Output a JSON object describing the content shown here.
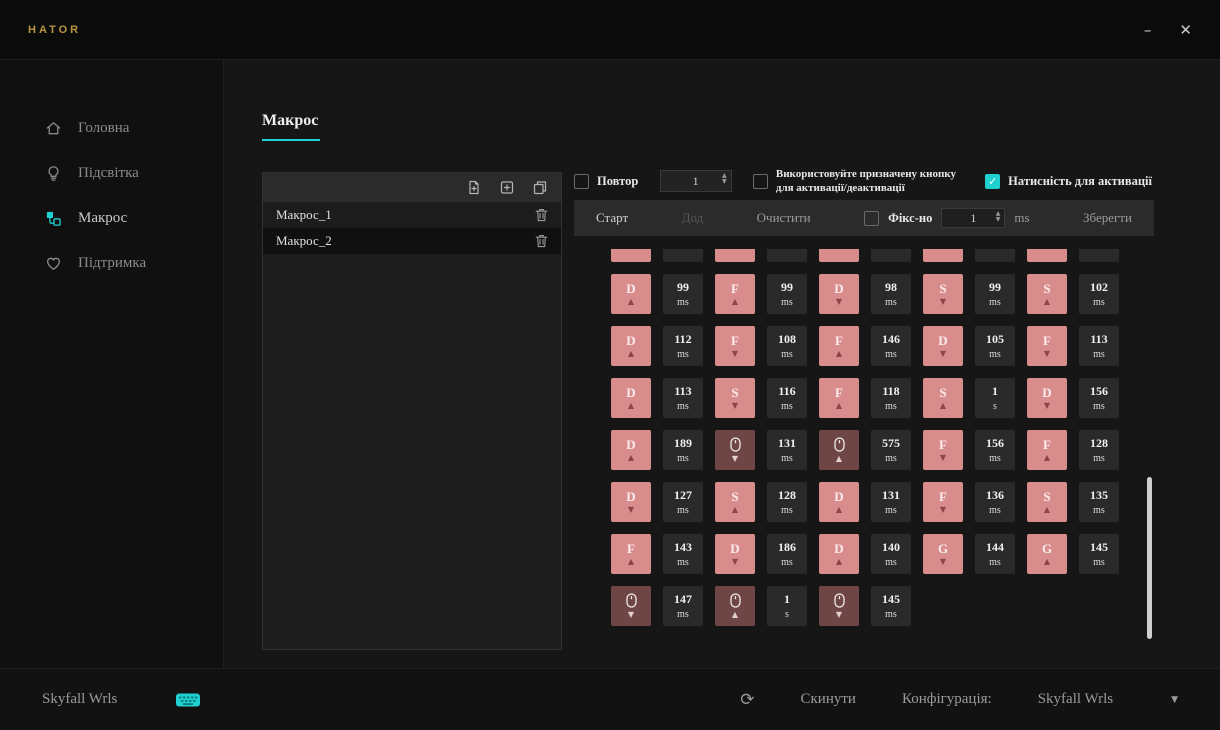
{
  "topbar": {
    "brand": "HATOR",
    "minimize": "–",
    "close": "✕"
  },
  "sidebar": {
    "items": [
      {
        "label": "Головна",
        "icon": "home-icon",
        "active": false
      },
      {
        "label": "Підсвітка",
        "icon": "bulb-icon",
        "active": false
      },
      {
        "label": "Макрос",
        "icon": "macro-icon",
        "active": true
      },
      {
        "label": "Підтримка",
        "icon": "heart-icon",
        "active": false
      }
    ]
  },
  "page": {
    "title": "Макрос"
  },
  "macro_list": {
    "toolbar_icons": [
      "new-file-icon",
      "add-file-icon",
      "copy-icon"
    ],
    "items": [
      {
        "name": "Макрос_1",
        "selected": false
      },
      {
        "name": "Макрос_2",
        "selected": true
      }
    ]
  },
  "controls": {
    "repeat": {
      "label": "Повтор",
      "checked": false,
      "value": "1"
    },
    "assigned_button": {
      "label": "Використовуйте призначену кнопку для активації/деактивації",
      "checked": false
    },
    "press_to_activate": {
      "label": "Натисність для активації",
      "checked": true
    }
  },
  "action_bar": {
    "start": "Старт",
    "add": "Дод",
    "clear": "Очистити",
    "fixed": {
      "label": "Фікс-но",
      "checked": false,
      "value": "1",
      "unit": "ms"
    },
    "save": "Зберегти"
  },
  "events": {
    "partial_top_row_pairs": 5,
    "rows": [
      [
        {
          "key": "D",
          "dir": "up",
          "time": "99",
          "unit": "ms"
        },
        {
          "key": "F",
          "dir": "up",
          "time": "99",
          "unit": "ms"
        },
        {
          "key": "D",
          "dir": "down",
          "time": "98",
          "unit": "ms"
        },
        {
          "key": "S",
          "dir": "down",
          "time": "99",
          "unit": "ms"
        },
        {
          "key": "S",
          "dir": "up",
          "time": "102",
          "unit": "ms"
        }
      ],
      [
        {
          "key": "D",
          "dir": "up",
          "time": "112",
          "unit": "ms"
        },
        {
          "key": "F",
          "dir": "down",
          "time": "108",
          "unit": "ms"
        },
        {
          "key": "F",
          "dir": "up",
          "time": "146",
          "unit": "ms"
        },
        {
          "key": "D",
          "dir": "down",
          "time": "105",
          "unit": "ms"
        },
        {
          "key": "F",
          "dir": "down",
          "time": "113",
          "unit": "ms"
        }
      ],
      [
        {
          "key": "D",
          "dir": "up",
          "time": "113",
          "unit": "ms"
        },
        {
          "key": "S",
          "dir": "down",
          "time": "116",
          "unit": "ms"
        },
        {
          "key": "F",
          "dir": "up",
          "time": "118",
          "unit": "ms"
        },
        {
          "key": "S",
          "dir": "up",
          "time": "1",
          "unit": "s"
        },
        {
          "key": "D",
          "dir": "down",
          "time": "156",
          "unit": "ms"
        }
      ],
      [
        {
          "key": "D",
          "dir": "up",
          "time": "189",
          "unit": "ms"
        },
        {
          "key": "mouse",
          "dir": "down",
          "time": "131",
          "unit": "ms"
        },
        {
          "key": "mouse",
          "dir": "up",
          "time": "575",
          "unit": "ms"
        },
        {
          "key": "F",
          "dir": "down",
          "time": "156",
          "unit": "ms"
        },
        {
          "key": "F",
          "dir": "up",
          "time": "128",
          "unit": "ms"
        }
      ],
      [
        {
          "key": "D",
          "dir": "down",
          "time": "127",
          "unit": "ms"
        },
        {
          "key": "S",
          "dir": "up",
          "time": "128",
          "unit": "ms"
        },
        {
          "key": "D",
          "dir": "up",
          "time": "131",
          "unit": "ms"
        },
        {
          "key": "F",
          "dir": "down",
          "time": "136",
          "unit": "ms"
        },
        {
          "key": "S",
          "dir": "up",
          "time": "135",
          "unit": "ms"
        }
      ],
      [
        {
          "key": "F",
          "dir": "up",
          "time": "143",
          "unit": "ms"
        },
        {
          "key": "D",
          "dir": "down",
          "time": "186",
          "unit": "ms"
        },
        {
          "key": "D",
          "dir": "up",
          "time": "140",
          "unit": "ms"
        },
        {
          "key": "G",
          "dir": "down",
          "time": "144",
          "unit": "ms"
        },
        {
          "key": "G",
          "dir": "up",
          "time": "145",
          "unit": "ms"
        }
      ],
      [
        {
          "key": "mouse",
          "dir": "down",
          "time": "147",
          "unit": "ms"
        },
        {
          "key": "mouse",
          "dir": "up",
          "time": "1",
          "unit": "s"
        },
        {
          "key": "mouse",
          "dir": "down",
          "time": "145",
          "unit": "ms"
        }
      ]
    ]
  },
  "footer": {
    "device": "Skyfall Wrls",
    "reset": "Скинути",
    "config_label": "Конфігурація:",
    "config_value": "Skyfall Wrls"
  },
  "colors": {
    "accent": "#1fd0d0",
    "brand_gold": "#b9973f",
    "key_cell": "#d98c8c",
    "mouse_cell": "#6f4646",
    "time_cell": "#2a2a2a"
  }
}
